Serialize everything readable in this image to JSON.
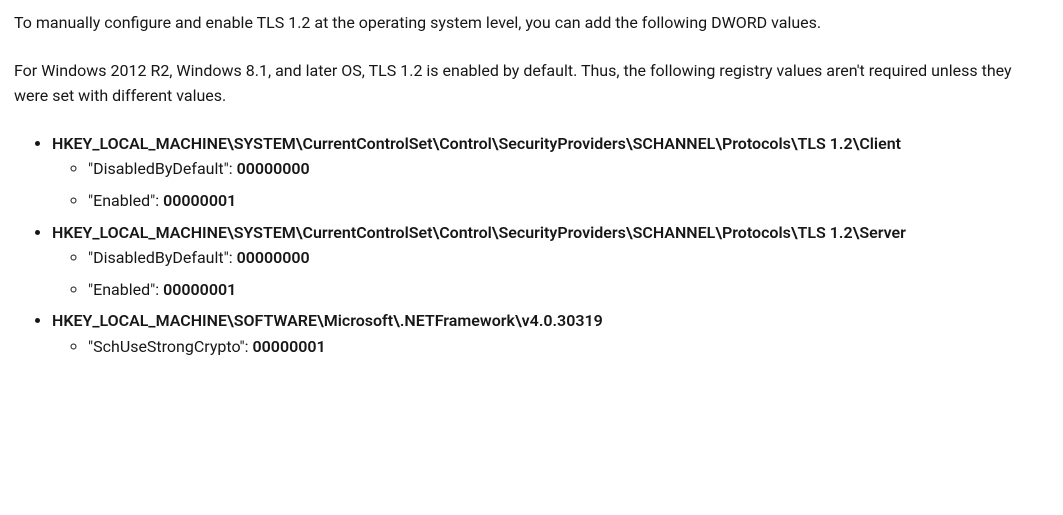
{
  "intro": {
    "p1": "To manually configure and enable TLS 1.2 at the operating system level, you can add the following DWORD values.",
    "p2": "For Windows 2012 R2, Windows 8.1, and later OS, TLS 1.2 is enabled by default. Thus, the following registry values aren't required unless they were set with different values."
  },
  "registry_keys": [
    {
      "path": "HKEY_LOCAL_MACHINE\\SYSTEM\\CurrentControlSet\\Control\\SecurityProviders\\SCHANNEL\\Protocols\\TLS 1.2\\Client",
      "values": [
        {
          "name": "\"DisabledByDefault\": ",
          "value": "00000000"
        },
        {
          "name": "\"Enabled\": ",
          "value": "00000001"
        }
      ]
    },
    {
      "path": "HKEY_LOCAL_MACHINE\\SYSTEM\\CurrentControlSet\\Control\\SecurityProviders\\SCHANNEL\\Protocols\\TLS 1.2\\Server",
      "values": [
        {
          "name": "\"DisabledByDefault\": ",
          "value": "00000000"
        },
        {
          "name": "\"Enabled\": ",
          "value": "00000001"
        }
      ]
    },
    {
      "path": "HKEY_LOCAL_MACHINE\\SOFTWARE\\Microsoft\\.NETFramework\\v4.0.30319",
      "values": [
        {
          "name": "\"SchUseStrongCrypto\": ",
          "value": "00000001"
        }
      ]
    }
  ]
}
